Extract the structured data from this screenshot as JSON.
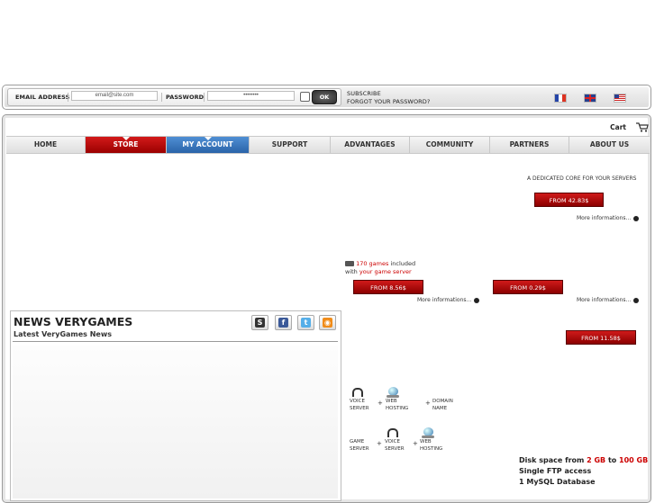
{
  "login": {
    "email_label": "EMAIL ADDRESS",
    "email_value": "email@site.com",
    "password_label": "PASSWORD",
    "password_value": "••••••••",
    "ok_label": "OK",
    "subscribe_label": "SUBSCRIBE",
    "forgot_label": "FORGOT YOUR PASSWORD?"
  },
  "header": {
    "cart_label": "Cart"
  },
  "nav": {
    "items": [
      "HOME",
      "STORE",
      "MY ACCOUNT",
      "SUPPORT",
      "ADVANTAGES",
      "COMMUNITY",
      "PARTNERS",
      "ABOUT US"
    ]
  },
  "promos": {
    "dedicated_text": "A DEDICATED CORE FOR YOUR SERVERS",
    "btn1": "FROM 42.83$",
    "more1": "More informations...",
    "games_count": "170 games",
    "games_included": " included",
    "games_with": "with ",
    "games_server": "your game server",
    "btn2": "FROM 8.56$",
    "more2": "More informations...",
    "btn3": "FROM 0.29$",
    "more3": "More informations...",
    "btn4": "FROM 11.58$"
  },
  "news": {
    "title": "NEWS VERYGAMES",
    "subtitle": "Latest VeryGames News"
  },
  "bundles": {
    "b1_voice": "VOICE\nSERVER",
    "b1_web": "WEB\nHOSTING",
    "b1_domain": "DOMAIN\nNAME",
    "b2_game": "GAME\nSERVER",
    "b2_voice": "VOICE\nSERVER",
    "b2_web": "WEB\nHOSTING",
    "plus": "+"
  },
  "hosting": {
    "disk_prefix": "Disk space from ",
    "disk_from": "2 GB",
    "disk_to_word": " to ",
    "disk_to": "100 GB",
    "ftp": "Single FTP access",
    "mysql": "1 MySQL Database"
  },
  "colors": {
    "accent_red": "#c00000",
    "accent_blue": "#3a78c2"
  }
}
